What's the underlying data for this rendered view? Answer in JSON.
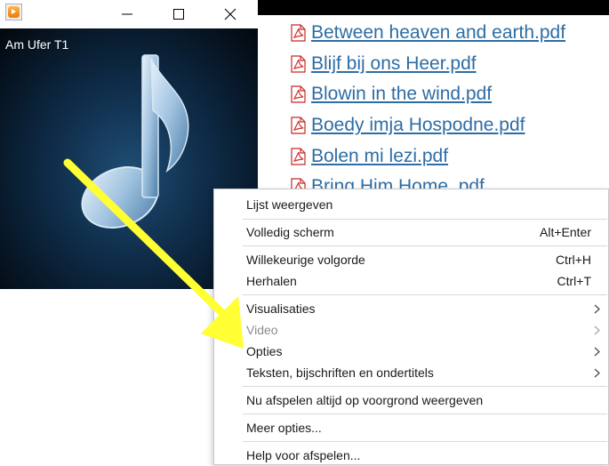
{
  "player": {
    "track_title": "Am Ufer T1",
    "app_icon": "windows-media-player-icon",
    "music_icon": "music-note-icon",
    "controls": [
      "minimize-icon",
      "maximize-icon",
      "close-icon"
    ]
  },
  "files": [
    "Between heaven and earth.pdf",
    "Blijf bij ons Heer.pdf",
    "Blowin in the wind.pdf",
    "Boedy imja Hospodne.pdf",
    "Bolen mi lezi.pdf",
    "Bring Him Home .pdf"
  ],
  "menu": {
    "list_view": "Lijst weergeven",
    "full_screen": "Volledig scherm",
    "full_screen_shortcut": "Alt+Enter",
    "shuffle": "Willekeurige volgorde",
    "shuffle_shortcut": "Ctrl+H",
    "repeat": "Herhalen",
    "repeat_shortcut": "Ctrl+T",
    "visualizations": "Visualisaties",
    "video": "Video",
    "options": "Opties",
    "lyrics": "Teksten, bijschriften en ondertitels",
    "always_on_top": "Nu afspelen altijd op voorgrond weergeven",
    "more_options": "Meer opties...",
    "help": "Help voor afspelen..."
  },
  "colors": {
    "link": "#2e6da4",
    "arrow": "#ffff33",
    "menu_disabled": "#8c8c8c"
  }
}
